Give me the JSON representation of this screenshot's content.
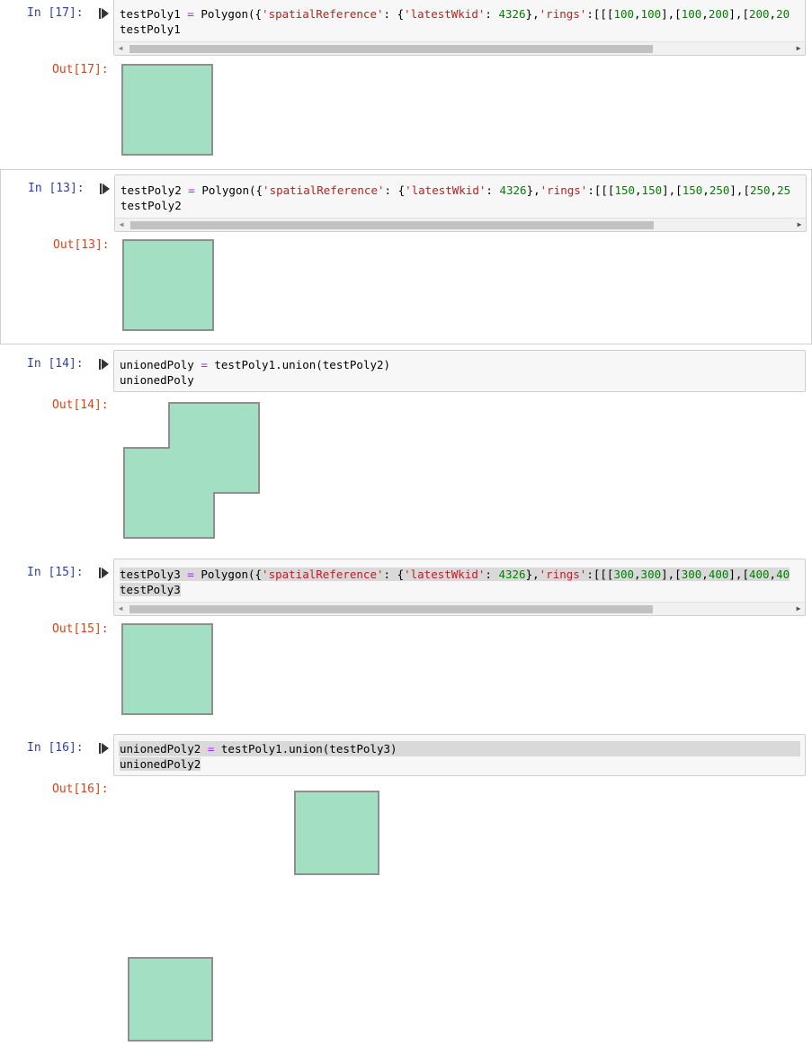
{
  "cells": [
    {
      "in_prompt": "In [17]:",
      "out_prompt": "Out[17]:",
      "code": {
        "l1_var": "testPoly1",
        "l1_eq": " = ",
        "l1_fn": "Polygon({",
        "l1_k1": "'spatialReference'",
        "l1_mid1": ": {",
        "l1_k2": "'latestWkid'",
        "l1_mid2": ": ",
        "l1_n": "4326",
        "l1_mid3": "},",
        "l1_k3": "'rings'",
        "l1_mid4": ":[[[",
        "l1_a": "100",
        "l1_c1": ",",
        "l1_b": "100",
        "l1_c2": "],[",
        "l1_c": "100",
        "l1_c3": ",",
        "l1_d": "200",
        "l1_c4": "],[",
        "l1_e": "200",
        "l1_c5": ",",
        "l1_f": "20",
        "l2": "testPoly1"
      }
    },
    {
      "in_prompt": "In [13]:",
      "out_prompt": "Out[13]:",
      "code": {
        "l1_var": "testPoly2",
        "l1_eq": " = ",
        "l1_fn": "Polygon({",
        "l1_k1": "'spatialReference'",
        "l1_mid1": ": {",
        "l1_k2": "'latestWkid'",
        "l1_mid2": ": ",
        "l1_n": "4326",
        "l1_mid3": "},",
        "l1_k3": "'rings'",
        "l1_mid4": ":[[[",
        "l1_a": "150",
        "l1_c1": ",",
        "l1_b": "150",
        "l1_c2": "],[",
        "l1_c": "150",
        "l1_c3": ",",
        "l1_d": "250",
        "l1_c4": "],[",
        "l1_e": "250",
        "l1_c5": ",",
        "l1_f": "25",
        "l2": "testPoly2"
      }
    },
    {
      "in_prompt": "In [14]:",
      "out_prompt": "Out[14]:",
      "code": {
        "l1_var": "unionedPoly",
        "l1_eq": " = ",
        "l1_rest": "testPoly1.union(testPoly2)",
        "l2": "unionedPoly"
      }
    },
    {
      "in_prompt": "In [15]:",
      "out_prompt": "Out[15]:",
      "code": {
        "l1_var": "testPoly3",
        "l1_eq": " = ",
        "l1_fn": "Polygon({",
        "l1_k1": "'spatialReference'",
        "l1_mid1": ": {",
        "l1_k2": "'latestWkid'",
        "l1_mid2": ": ",
        "l1_n": "4326",
        "l1_mid3": "},",
        "l1_k3": "'rings'",
        "l1_mid4": ":[[[",
        "l1_a": "300",
        "l1_c1": ",",
        "l1_b": "300",
        "l1_c2": "],[",
        "l1_c": "300",
        "l1_c3": ",",
        "l1_d": "400",
        "l1_c4": "],[",
        "l1_e": "400",
        "l1_c5": ",",
        "l1_f": "40",
        "l2": "testPoly3"
      }
    },
    {
      "in_prompt": "In [16]:",
      "out_prompt": "Out[16]:",
      "code": {
        "l1_var": "unionedPoly2",
        "l1_eq": " = ",
        "l1_rest": "testPoly1.union(testPoly3)",
        "l2": "unionedPoly2"
      }
    }
  ],
  "colors": {
    "polygon_fill": "#a3dfc2",
    "polygon_stroke": "#8f8f8f",
    "in_prompt": "#303f9f",
    "out_prompt": "#d84315",
    "string": "#ba2121",
    "number": "#008000",
    "operator": "#aa22ff"
  },
  "icons": {
    "run": "run-cell-icon",
    "scroll_left": "scroll-left-icon",
    "scroll_right": "scroll-right-icon"
  }
}
